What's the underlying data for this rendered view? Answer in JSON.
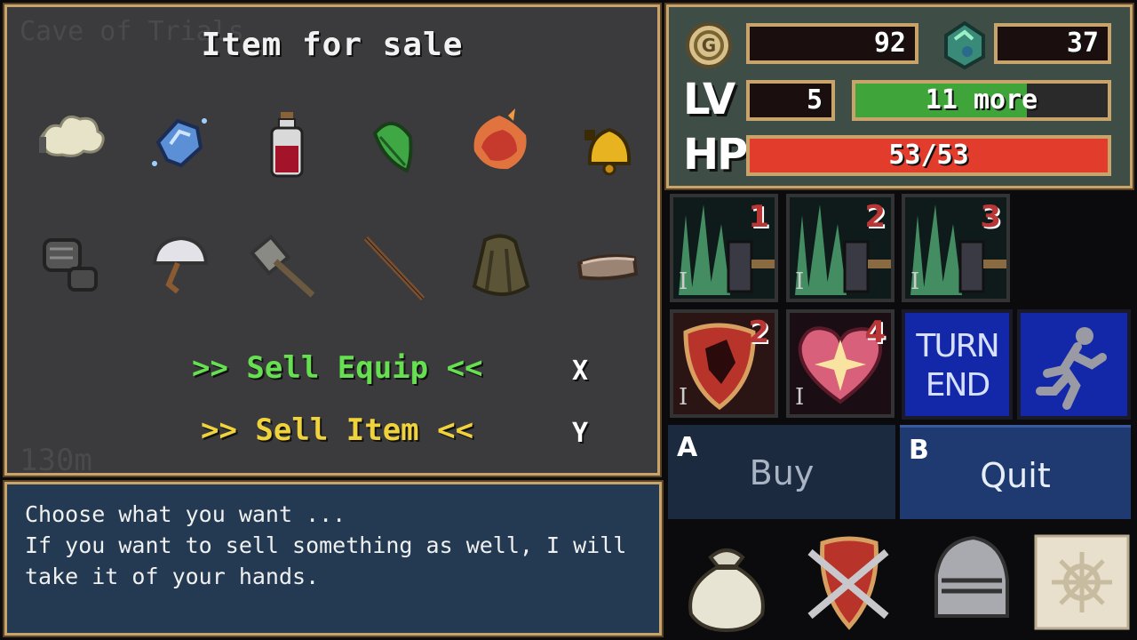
{
  "shop": {
    "title": "Item for sale",
    "ghost_title": "Cave of Trials",
    "ghost_depth": "130m",
    "items_row1": [
      "cloud-item",
      "blue-gem-item",
      "red-potion-item",
      "green-leaf-item",
      "fire-meat-item",
      "golden-bell-item"
    ],
    "items_row2": [
      "gauntlet-item",
      "helmet-item",
      "war-hammer-item",
      "staff-item",
      "cloak-item",
      "bread-item"
    ],
    "sell_equip": ">> Sell Equip <<",
    "sell_item": ">> Sell Item <<",
    "key_x": "X",
    "key_y": "Y",
    "colors": {
      "sell_equip": "#66e050",
      "sell_item": "#f0d23c"
    }
  },
  "dialog": {
    "text": "Choose what you want ...\nIf you want to sell something as well, I will\ntake it of your hands."
  },
  "stats": {
    "gold": "92",
    "gems": "37",
    "lv_label": "LV",
    "level": "5",
    "exp_text": "11 more",
    "exp_fraction": 0.68,
    "hp_label": "HP",
    "hp_text": "53/53",
    "hp_fraction": 1.0,
    "colors": {
      "exp": "#3fa43a",
      "hp": "#e23c2c"
    }
  },
  "cards": [
    {
      "name": "spike-attack-card",
      "num": "1",
      "tier": "I"
    },
    {
      "name": "spike-attack-card",
      "num": "2",
      "tier": "I"
    },
    {
      "name": "spike-attack-card",
      "num": "3",
      "tier": "I"
    },
    {
      "name": "shield-card",
      "num": "2",
      "tier": "I"
    },
    {
      "name": "heart-card",
      "num": "4",
      "tier": "I"
    }
  ],
  "turn_end": [
    "TURN",
    "END"
  ],
  "buttons": {
    "buy_key": "A",
    "buy_label": "Buy",
    "quit_key": "B",
    "quit_label": "Quit"
  },
  "bottom_icons": [
    "bag-icon",
    "emblem-icon",
    "knight-helmet-icon",
    "map-icon"
  ]
}
